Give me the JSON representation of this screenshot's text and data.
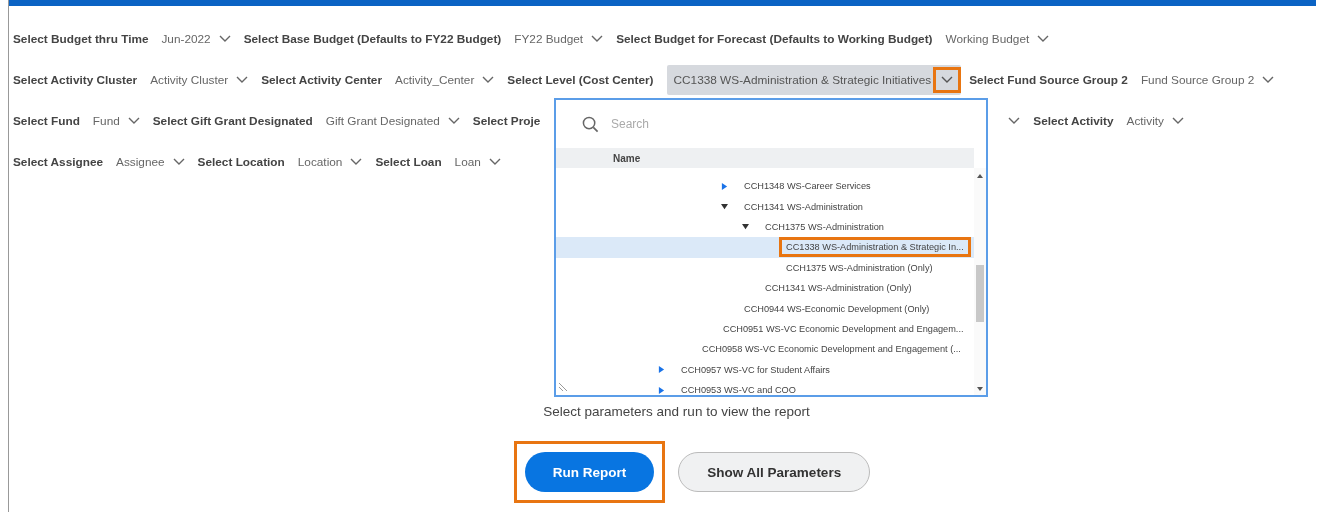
{
  "rows": [
    [
      {
        "kind": "param",
        "label": "Select Budget thru Time",
        "value": "Jun-2022"
      },
      {
        "kind": "param",
        "label": "Select Base Budget (Defaults to FY22 Budget)",
        "value": "FY22 Budget"
      },
      {
        "kind": "param",
        "label": "Select Budget for Forecast (Defaults to Working Budget)",
        "value": "Working Budget"
      }
    ],
    [
      {
        "kind": "param",
        "label": "Select Activity Cluster",
        "value": "Activity Cluster"
      },
      {
        "kind": "param",
        "label": "Select Activity Center",
        "value": "Activity_Center"
      },
      {
        "kind": "selected",
        "label": "Select Level (Cost Center)",
        "value": "CC1338 WS-Administration & Strategic Initiatives",
        "open": true,
        "highlighted": true
      },
      {
        "kind": "param",
        "label": "Select Fund Source Group 2",
        "value": "Fund Source Group 2"
      }
    ],
    [
      {
        "kind": "param",
        "label": "Select Fund",
        "value": "Fund"
      },
      {
        "kind": "param",
        "label": "Select Gift Grant Designated",
        "value": "Gift Grant Designated"
      },
      {
        "kind": "label",
        "label": "Select Proje"
      },
      {
        "kind": "covered"
      },
      {
        "kind": "param",
        "label": "Select Activity",
        "value": "Activity"
      }
    ],
    [
      {
        "kind": "param",
        "label": "Select Assignee",
        "value": "Assignee"
      },
      {
        "kind": "param",
        "label": "Select Location",
        "value": "Location"
      },
      {
        "kind": "param",
        "label": "Select Loan",
        "value": "Loan"
      }
    ]
  ],
  "popup": {
    "search": {
      "placeholder": "Search"
    },
    "column": "Name",
    "tree": [
      {
        "children": [
          {
            "children": [
              {
                "children": [
                  {
                    "label": "CCH1348 WS-Career Services",
                    "expanded": false,
                    "selected": false
                  },
                  {
                    "label": "CCH1341 WS-Administration",
                    "expanded": true,
                    "selected": false,
                    "children": [
                      {
                        "label": "CCH1375 WS-Administration",
                        "expanded": true,
                        "selected": false,
                        "children": [
                          {
                            "label": "CC1338 WS-Administration & Strategic In...",
                            "selected": true,
                            "highlighted": true
                          },
                          {
                            "label": "CCH1375 WS-Administration (Only)",
                            "selected": false
                          }
                        ]
                      },
                      {
                        "label": "CCH1341 WS-Administration (Only)",
                        "selected": false
                      }
                    ]
                  },
                  {
                    "label": "CCH0944 WS-Economic Development (Only)",
                    "selected": false
                  }
                ]
              },
              {
                "label": "CCH0951 WS-VC Economic Development and Engagem...",
                "selected": false
              }
            ]
          },
          {
            "label": "CCH0958 WS-VC Economic Development and Engagement (...",
            "selected": false
          }
        ]
      },
      {
        "label": "CCH0957 WS-VC for Student Affairs",
        "expanded": false,
        "selected": false
      },
      {
        "label": "CCH0953 WS-VC and COO",
        "expanded": false,
        "selected": false
      }
    ]
  },
  "message": "Select parameters and run to view the report",
  "buttons": [
    {
      "label": "Run Report",
      "kind": "primary",
      "highlighted": true
    },
    {
      "label": "Show All Parameters",
      "kind": "secondary",
      "highlighted": false
    }
  ]
}
